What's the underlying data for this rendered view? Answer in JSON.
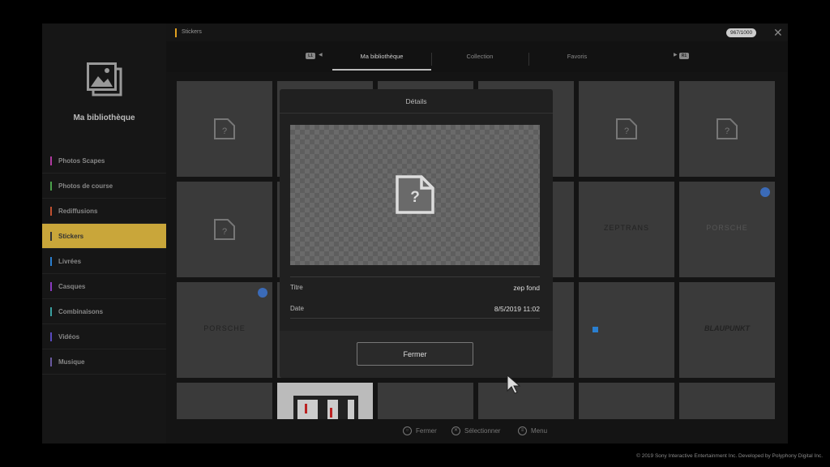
{
  "sidebar": {
    "title": "Ma bibliothèque",
    "items": [
      {
        "label": "Photos Scapes",
        "color": "#b03aa0"
      },
      {
        "label": "Photos de course",
        "color": "#4aa04a"
      },
      {
        "label": "Rediffusions",
        "color": "#c05030"
      },
      {
        "label": "Stickers",
        "color": "#333333"
      },
      {
        "label": "Livrées",
        "color": "#2a7fd0"
      },
      {
        "label": "Casques",
        "color": "#8a3ac0"
      },
      {
        "label": "Combinaisons",
        "color": "#3aa0a0"
      },
      {
        "label": "Vidéos",
        "color": "#5a4ac0"
      },
      {
        "label": "Musique",
        "color": "#6a5aa0"
      }
    ],
    "active_index": 3
  },
  "topbar": {
    "breadcrumb": "Stickers",
    "count": "967/1000",
    "close": "✕"
  },
  "tabs": {
    "left_button": "L1",
    "right_button": "R1",
    "items": [
      "Ma bibliothèque",
      "Collection",
      "Favoris"
    ],
    "active_index": 0
  },
  "grid": {
    "logos": [
      "ZEPTRANS",
      "PORSCHE",
      "PORSCHE",
      "BLAUPUNKT"
    ]
  },
  "modal": {
    "title": "Détails",
    "fields": [
      {
        "label": "Titre",
        "value": "zep fond"
      },
      {
        "label": "Date",
        "value": "8/5/2019 11:02"
      }
    ],
    "button": "Fermer"
  },
  "bottombar": {
    "hints": [
      {
        "icon": "circle-button-icon",
        "label": "Fermer"
      },
      {
        "icon": "cross-button-icon",
        "label": "Sélectionner"
      },
      {
        "icon": "options-button-icon",
        "label": "Menu"
      }
    ]
  },
  "copyright": "© 2019 Sony Interactive Entertainment Inc. Developed by Polyphony Digital Inc."
}
